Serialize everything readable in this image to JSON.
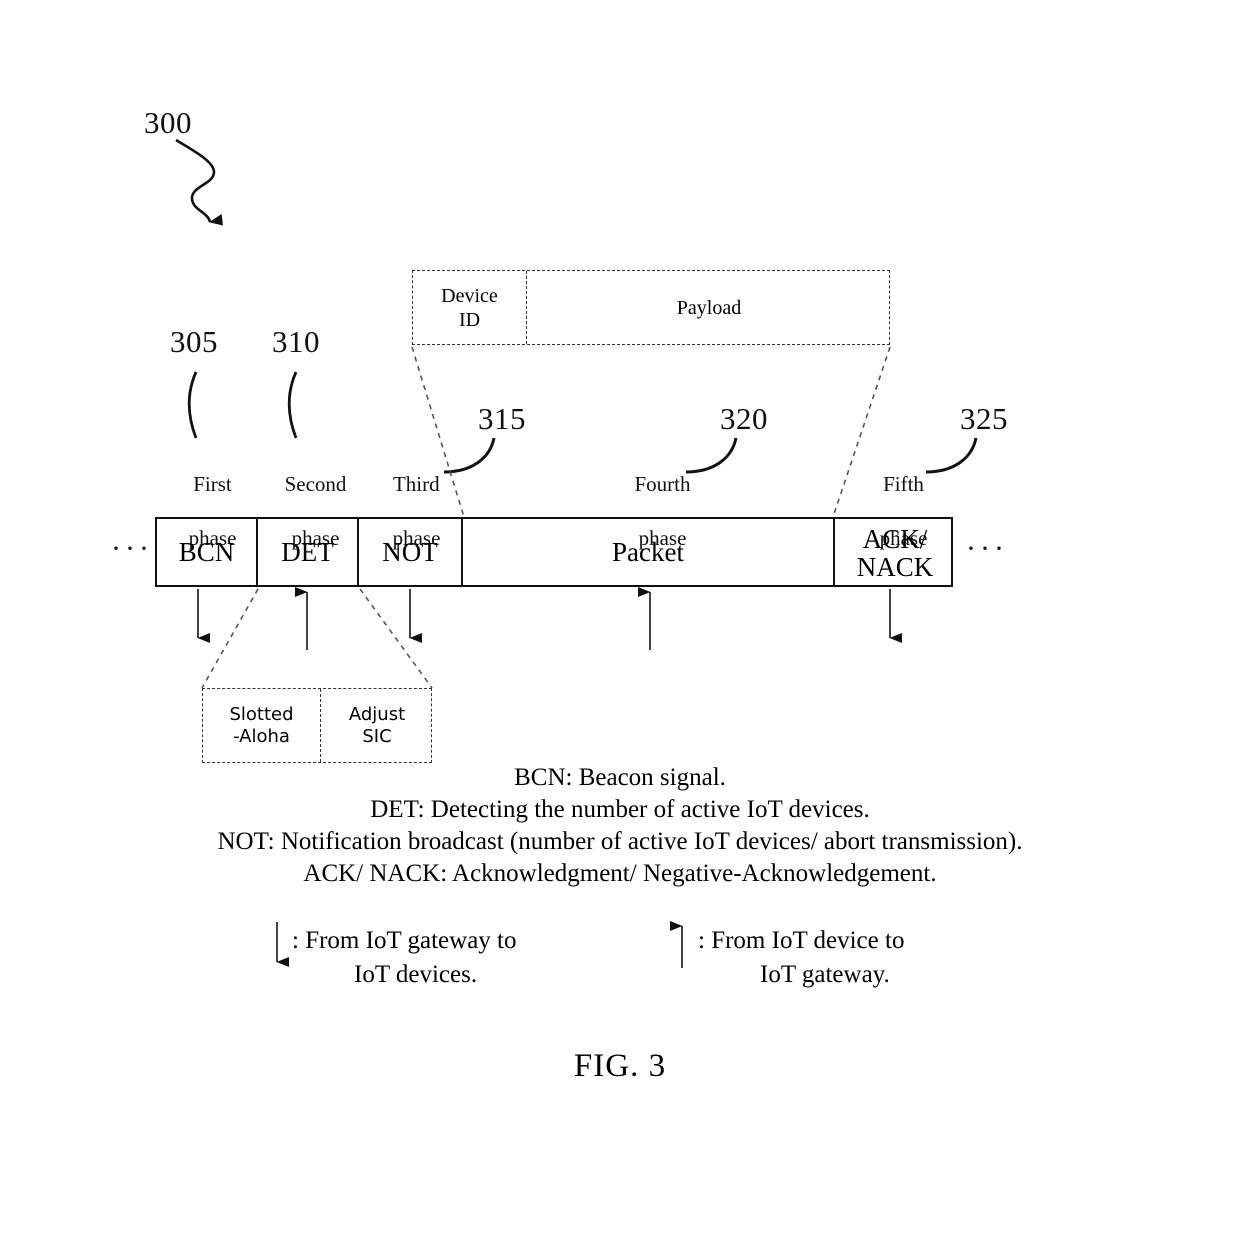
{
  "figure": {
    "caption": "FIG. 3",
    "main_ref": "300"
  },
  "frame": {
    "left_ellipsis": "···",
    "right_ellipsis": "···",
    "cells": [
      {
        "label": "BCN",
        "direction": "down"
      },
      {
        "label": "DET",
        "direction": "up"
      },
      {
        "label": "NOT",
        "direction": "down"
      },
      {
        "label": "Packet",
        "direction": "up"
      },
      {
        "label_line1": "ACK/",
        "label_line2": "NACK",
        "direction": "down"
      }
    ]
  },
  "phases": [
    {
      "ref": "305",
      "line1": "First",
      "line2": "phase"
    },
    {
      "ref": "310",
      "line1": "Second",
      "line2": "phase"
    },
    {
      "ref": "315",
      "line1": "Third",
      "line2": "phase"
    },
    {
      "ref": "320",
      "line1": "Fourth",
      "line2": "phase"
    },
    {
      "ref": "325",
      "line1": "Fifth",
      "line2": "phase"
    }
  ],
  "packet_detail": {
    "device_id_line1": "Device",
    "device_id_line2": "ID",
    "payload": "Payload"
  },
  "det_detail": {
    "slotted_line1": "Slotted",
    "slotted_line2": "-Aloha",
    "adjust_line1": "Adjust",
    "adjust_line2": "SIC"
  },
  "legend": {
    "line1": "BCN: Beacon signal.",
    "line2": "DET: Detecting the number of active IoT devices.",
    "line3": "NOT: Notification broadcast (number of active IoT devices/ abort transmission).",
    "line4": "ACK/ NACK: Acknowledgment/ Negative-Acknowledgement."
  },
  "arrow_legend": {
    "downlink_line1": ": From IoT gateway to",
    "downlink_line2": "IoT devices.",
    "uplink_line1": ": From IoT device to",
    "uplink_line2": "IoT gateway."
  },
  "colors": {
    "ink": "#111111",
    "dashed": "#333333",
    "background": "#ffffff"
  }
}
